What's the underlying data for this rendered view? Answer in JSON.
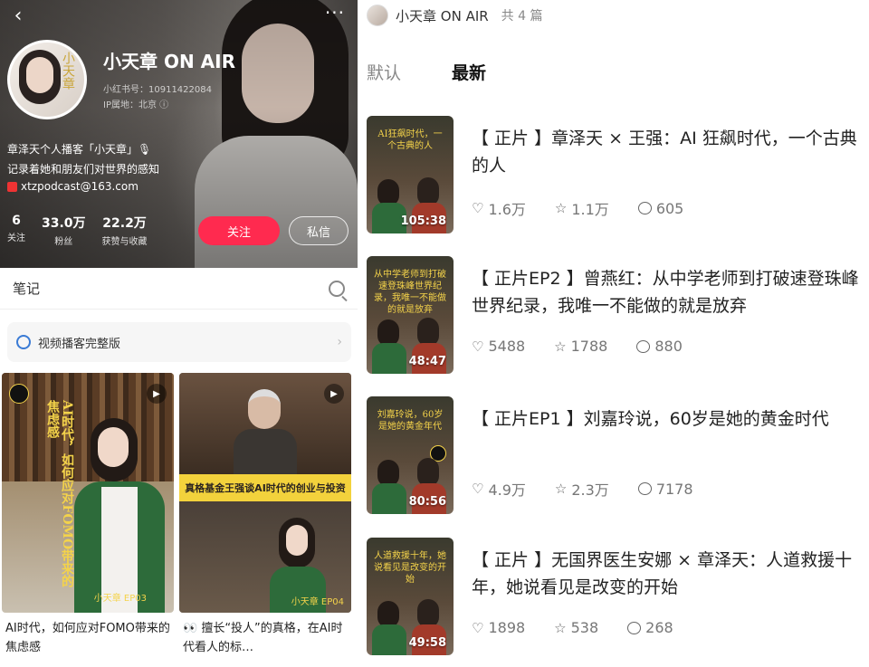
{
  "profile": {
    "name": "小天章 ON AIR",
    "id_text": "小红书号：10911422084",
    "ip_text": "IP属地：北京 ⓘ",
    "bio_line1": "章泽天个人播客「小天章」🎙",
    "bio_line2": "记录着她和朋友们对世界的感知",
    "email": "xtzpodcast@163.com",
    "avatar_text": "小天章",
    "stats": [
      {
        "num": "6",
        "label": "关注"
      },
      {
        "num": "33.0万",
        "label": "粉丝"
      },
      {
        "num": "22.2万",
        "label": "获赞与收藏"
      }
    ],
    "follow_label": "关注",
    "message_label": "私信"
  },
  "notes_bar": {
    "title": "笔记"
  },
  "collection": {
    "label": "视频播客完整版"
  },
  "cards": [
    {
      "caption": "AI时代，如何应对FOMO带来的焦虑感",
      "vertical_text": "AI时代，如何应对FOMO带来的焦虑感",
      "signature": "小天章 EP03"
    },
    {
      "caption": "👀 擅长“投人”的真格，在AI时代看人的标…",
      "banner": "真格基金王强谈AI时代的创业与投资",
      "signature": "小天章 EP04"
    }
  ],
  "right": {
    "header_name": "小天章 ON AIR",
    "header_count": "共 4 篇",
    "tabs": [
      "默认",
      "最新"
    ],
    "active_tab": "最新",
    "episodes": [
      {
        "thumb_title": "AI狂飙时代，一个古典的人",
        "duration": "105:38",
        "title": "【 正片 】章泽天 × 王强：AI 狂飙时代，一个古典的人",
        "likes": "1.6万",
        "stars": "1.1万",
        "comments": "605"
      },
      {
        "thumb_title": "从中学老师到打破速登珠峰世界纪录，我唯一不能做的就是放弃",
        "duration": "48:47",
        "title": "【 正片EP2 】曾燕红：从中学老师到打破速登珠峰世界纪录，我唯一不能做的就是放弃",
        "likes": "5488",
        "stars": "1788",
        "comments": "880"
      },
      {
        "thumb_title": "刘嘉玲说，60岁是她的黄金年代",
        "duration": "80:56",
        "title": "【 正片EP1 】刘嘉玲说，60岁是她的黄金时代",
        "likes": "4.9万",
        "stars": "2.3万",
        "comments": "7178"
      },
      {
        "thumb_title": "人道救援十年，她说看见是改变的开始",
        "duration": "49:58",
        "title": "【 正片 】无国界医生安娜 × 章泽天：人道救援十年，她说看见是改变的开始",
        "likes": "1898",
        "stars": "538",
        "comments": "268"
      }
    ]
  },
  "icons": {
    "back": "chevron-left-icon",
    "more": "more-icon",
    "search": "search-icon",
    "heart": "heart-icon",
    "star": "star-icon",
    "comment": "comment-icon"
  },
  "colors": {
    "accent": "#ff2a4f",
    "title_yellow": "#f4d34a"
  }
}
